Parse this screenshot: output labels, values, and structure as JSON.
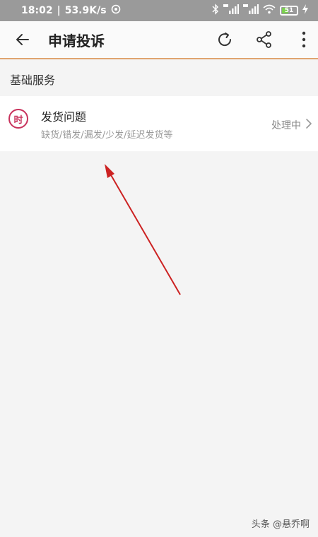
{
  "status_bar": {
    "time": "18:02",
    "separator": "|",
    "speed": "53.9K/s",
    "battery_level": "51",
    "battery_fraction": 0.51
  },
  "app_bar": {
    "title": "申请投诉",
    "icons": [
      "back-arrow-icon",
      "refresh-icon",
      "share-icon",
      "more-vertical-icon"
    ]
  },
  "section": {
    "label": "基础服务"
  },
  "list": {
    "items": [
      {
        "icon_text": "时",
        "title": "发货问题",
        "subtitle": "缺货/错发/漏发/少发/延迟发货等",
        "status": "处理中"
      }
    ]
  },
  "watermark": "头条 @悬乔啊",
  "colors": {
    "accent": "#c8325c",
    "app_bar_border": "#e0a46f",
    "annotation_arrow": "#cc2222",
    "status_bar_bg": "#9a9a9a",
    "page_bg": "#f4f4f4"
  }
}
